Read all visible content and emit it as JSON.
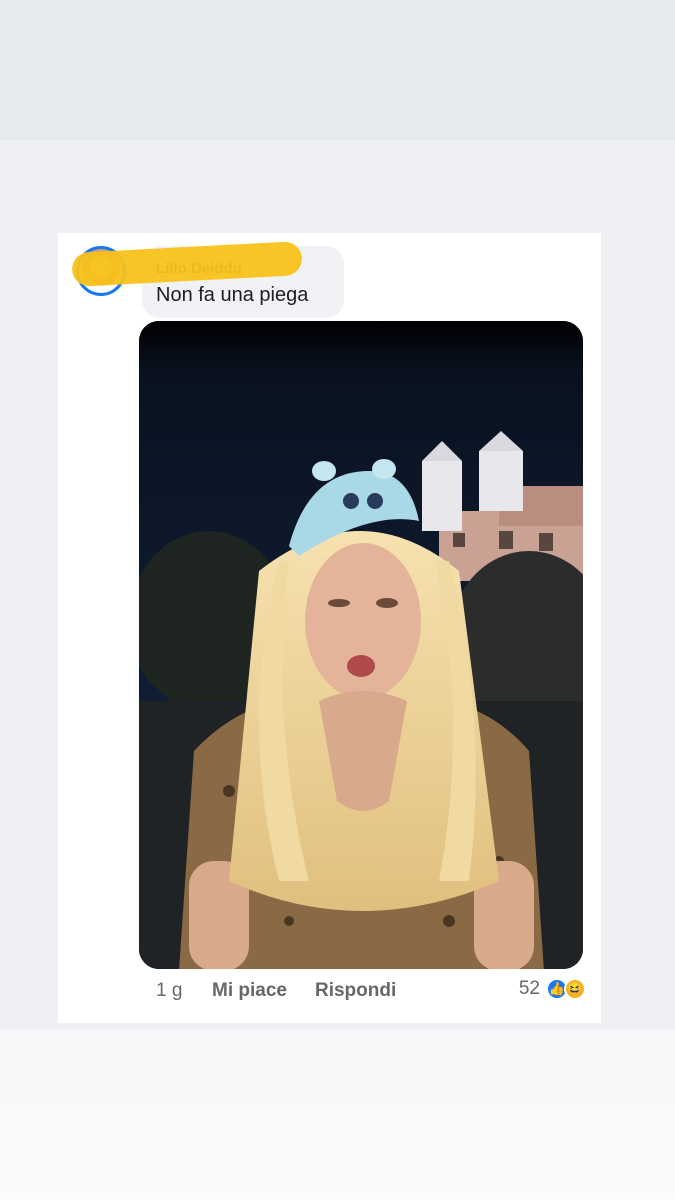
{
  "comment": {
    "author": "Lillo Deiddu",
    "text": "Non fa una piega",
    "time": "1 g",
    "like_label": "Mi piace",
    "reply_label": "Rispondi",
    "reaction_count": "52",
    "reactions": [
      "like-icon",
      "haha-icon"
    ]
  },
  "colors": {
    "accent": "#1877f2",
    "redaction": "#f8c21a",
    "bubble": "#f0f2f5"
  }
}
